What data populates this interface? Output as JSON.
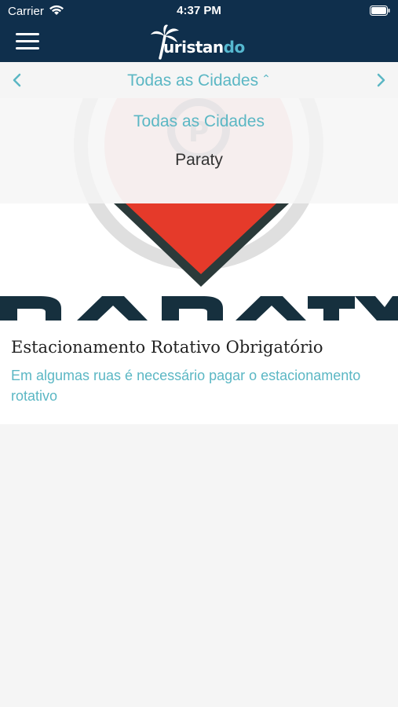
{
  "status_bar": {
    "carrier": "Carrier",
    "time": "4:37 PM"
  },
  "navbar": {
    "logo_prefix": "T",
    "logo_main": "uristan",
    "logo_accent": "do"
  },
  "city_selector": {
    "selected": "Todas as Cidades",
    "options": [
      "Todas as Cidades",
      "Paraty"
    ]
  },
  "card": {
    "title": "Estacionamento Rotativo Obrigatório",
    "description": "Em algumas ruas é necessário pagar o estacionamento rotativo"
  },
  "colors": {
    "header_bg": "#0f2f4c",
    "accent": "#5bb7c4",
    "red": "#e53a2a",
    "background": "#f5f5f5"
  }
}
